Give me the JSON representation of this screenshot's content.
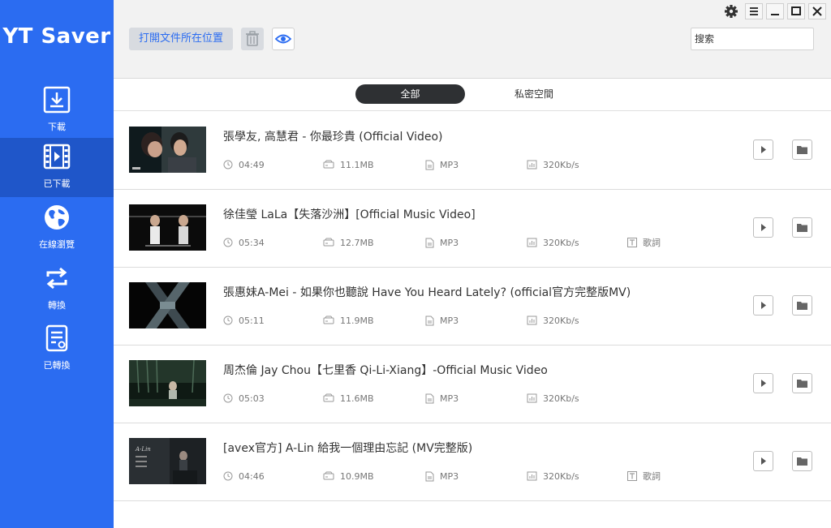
{
  "app": {
    "title": "YT Saver"
  },
  "sidebar": {
    "items": [
      {
        "label": "下載",
        "icon": "download-icon"
      },
      {
        "label": "已下載",
        "icon": "film-icon",
        "active": true
      },
      {
        "label": "在線瀏覽",
        "icon": "globe-icon"
      },
      {
        "label": "轉換",
        "icon": "convert-icon"
      },
      {
        "label": "已轉換",
        "icon": "converted-doc-icon"
      }
    ]
  },
  "toolbar": {
    "open_folder_label": "打開文件所在位置",
    "search_placeholder": "搜索"
  },
  "window_controls": [
    "gear-icon",
    "menu-icon",
    "minimize-icon",
    "maximize-icon",
    "close-icon"
  ],
  "tabs": [
    {
      "label": "全部",
      "active": true
    },
    {
      "label": "私密空間",
      "active": false
    }
  ],
  "items": [
    {
      "title": "張學友, 高慧君 - 你最珍貴 (Official Video)",
      "duration": "04:49",
      "size": "11.1MB",
      "format": "MP3",
      "bitrate": "320Kb/s",
      "lyrics": ""
    },
    {
      "title": "徐佳瑩 LaLa【失落沙洲】[Official Music Video]",
      "duration": "05:34",
      "size": "12.7MB",
      "format": "MP3",
      "bitrate": "320Kb/s",
      "lyrics": "歌詞"
    },
    {
      "title": "張惠妹A-Mei - 如果你也聽說 Have You Heard Lately? (official官方完整版MV)",
      "duration": "05:11",
      "size": "11.9MB",
      "format": "MP3",
      "bitrate": "320Kb/s",
      "lyrics": ""
    },
    {
      "title": "周杰倫 Jay Chou【七里香 Qi-Li-Xiang】-Official Music Video",
      "duration": "05:03",
      "size": "11.6MB",
      "format": "MP3",
      "bitrate": "320Kb/s",
      "lyrics": ""
    },
    {
      "title": "[avex官方] A-Lin 給我一個理由忘記 (MV完整版)",
      "duration": "04:46",
      "size": "10.9MB",
      "format": "MP3",
      "bitrate": "320Kb/s",
      "lyrics": "歌詞"
    }
  ],
  "colors": {
    "accent": "#2b6cf1",
    "sidebar_active": "#1f56c9",
    "tab_active_bg": "#2e3033"
  }
}
